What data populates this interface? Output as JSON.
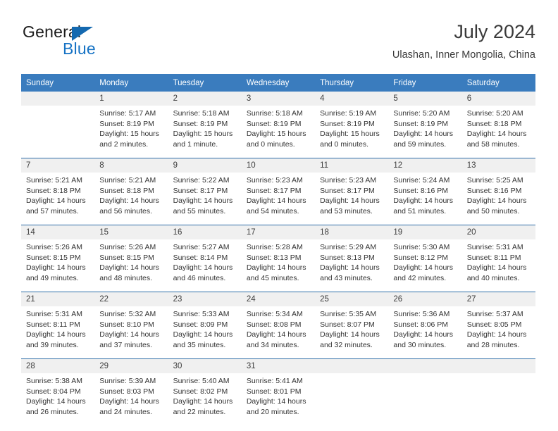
{
  "brand": {
    "name_dark": "General",
    "name_blue": "Blue",
    "accent_color": "#1572c4"
  },
  "header": {
    "title": "July 2024",
    "subtitle": "Ulashan, Inner Mongolia, China"
  },
  "calendar": {
    "header_bg": "#3a7cbe",
    "daynum_bg": "#f0f0f0",
    "week_rule_color": "#2f6ea8",
    "weekdays": [
      "Sunday",
      "Monday",
      "Tuesday",
      "Wednesday",
      "Thursday",
      "Friday",
      "Saturday"
    ],
    "weeks": [
      [
        {
          "day": "",
          "lines": []
        },
        {
          "day": "1",
          "lines": [
            "Sunrise: 5:17 AM",
            "Sunset: 8:19 PM",
            "Daylight: 15 hours",
            "and 2 minutes."
          ]
        },
        {
          "day": "2",
          "lines": [
            "Sunrise: 5:18 AM",
            "Sunset: 8:19 PM",
            "Daylight: 15 hours",
            "and 1 minute."
          ]
        },
        {
          "day": "3",
          "lines": [
            "Sunrise: 5:18 AM",
            "Sunset: 8:19 PM",
            "Daylight: 15 hours",
            "and 0 minutes."
          ]
        },
        {
          "day": "4",
          "lines": [
            "Sunrise: 5:19 AM",
            "Sunset: 8:19 PM",
            "Daylight: 15 hours",
            "and 0 minutes."
          ]
        },
        {
          "day": "5",
          "lines": [
            "Sunrise: 5:20 AM",
            "Sunset: 8:19 PM",
            "Daylight: 14 hours",
            "and 59 minutes."
          ]
        },
        {
          "day": "6",
          "lines": [
            "Sunrise: 5:20 AM",
            "Sunset: 8:18 PM",
            "Daylight: 14 hours",
            "and 58 minutes."
          ]
        }
      ],
      [
        {
          "day": "7",
          "lines": [
            "Sunrise: 5:21 AM",
            "Sunset: 8:18 PM",
            "Daylight: 14 hours",
            "and 57 minutes."
          ]
        },
        {
          "day": "8",
          "lines": [
            "Sunrise: 5:21 AM",
            "Sunset: 8:18 PM",
            "Daylight: 14 hours",
            "and 56 minutes."
          ]
        },
        {
          "day": "9",
          "lines": [
            "Sunrise: 5:22 AM",
            "Sunset: 8:17 PM",
            "Daylight: 14 hours",
            "and 55 minutes."
          ]
        },
        {
          "day": "10",
          "lines": [
            "Sunrise: 5:23 AM",
            "Sunset: 8:17 PM",
            "Daylight: 14 hours",
            "and 54 minutes."
          ]
        },
        {
          "day": "11",
          "lines": [
            "Sunrise: 5:23 AM",
            "Sunset: 8:17 PM",
            "Daylight: 14 hours",
            "and 53 minutes."
          ]
        },
        {
          "day": "12",
          "lines": [
            "Sunrise: 5:24 AM",
            "Sunset: 8:16 PM",
            "Daylight: 14 hours",
            "and 51 minutes."
          ]
        },
        {
          "day": "13",
          "lines": [
            "Sunrise: 5:25 AM",
            "Sunset: 8:16 PM",
            "Daylight: 14 hours",
            "and 50 minutes."
          ]
        }
      ],
      [
        {
          "day": "14",
          "lines": [
            "Sunrise: 5:26 AM",
            "Sunset: 8:15 PM",
            "Daylight: 14 hours",
            "and 49 minutes."
          ]
        },
        {
          "day": "15",
          "lines": [
            "Sunrise: 5:26 AM",
            "Sunset: 8:15 PM",
            "Daylight: 14 hours",
            "and 48 minutes."
          ]
        },
        {
          "day": "16",
          "lines": [
            "Sunrise: 5:27 AM",
            "Sunset: 8:14 PM",
            "Daylight: 14 hours",
            "and 46 minutes."
          ]
        },
        {
          "day": "17",
          "lines": [
            "Sunrise: 5:28 AM",
            "Sunset: 8:13 PM",
            "Daylight: 14 hours",
            "and 45 minutes."
          ]
        },
        {
          "day": "18",
          "lines": [
            "Sunrise: 5:29 AM",
            "Sunset: 8:13 PM",
            "Daylight: 14 hours",
            "and 43 minutes."
          ]
        },
        {
          "day": "19",
          "lines": [
            "Sunrise: 5:30 AM",
            "Sunset: 8:12 PM",
            "Daylight: 14 hours",
            "and 42 minutes."
          ]
        },
        {
          "day": "20",
          "lines": [
            "Sunrise: 5:31 AM",
            "Sunset: 8:11 PM",
            "Daylight: 14 hours",
            "and 40 minutes."
          ]
        }
      ],
      [
        {
          "day": "21",
          "lines": [
            "Sunrise: 5:31 AM",
            "Sunset: 8:11 PM",
            "Daylight: 14 hours",
            "and 39 minutes."
          ]
        },
        {
          "day": "22",
          "lines": [
            "Sunrise: 5:32 AM",
            "Sunset: 8:10 PM",
            "Daylight: 14 hours",
            "and 37 minutes."
          ]
        },
        {
          "day": "23",
          "lines": [
            "Sunrise: 5:33 AM",
            "Sunset: 8:09 PM",
            "Daylight: 14 hours",
            "and 35 minutes."
          ]
        },
        {
          "day": "24",
          "lines": [
            "Sunrise: 5:34 AM",
            "Sunset: 8:08 PM",
            "Daylight: 14 hours",
            "and 34 minutes."
          ]
        },
        {
          "day": "25",
          "lines": [
            "Sunrise: 5:35 AM",
            "Sunset: 8:07 PM",
            "Daylight: 14 hours",
            "and 32 minutes."
          ]
        },
        {
          "day": "26",
          "lines": [
            "Sunrise: 5:36 AM",
            "Sunset: 8:06 PM",
            "Daylight: 14 hours",
            "and 30 minutes."
          ]
        },
        {
          "day": "27",
          "lines": [
            "Sunrise: 5:37 AM",
            "Sunset: 8:05 PM",
            "Daylight: 14 hours",
            "and 28 minutes."
          ]
        }
      ],
      [
        {
          "day": "28",
          "lines": [
            "Sunrise: 5:38 AM",
            "Sunset: 8:04 PM",
            "Daylight: 14 hours",
            "and 26 minutes."
          ]
        },
        {
          "day": "29",
          "lines": [
            "Sunrise: 5:39 AM",
            "Sunset: 8:03 PM",
            "Daylight: 14 hours",
            "and 24 minutes."
          ]
        },
        {
          "day": "30",
          "lines": [
            "Sunrise: 5:40 AM",
            "Sunset: 8:02 PM",
            "Daylight: 14 hours",
            "and 22 minutes."
          ]
        },
        {
          "day": "31",
          "lines": [
            "Sunrise: 5:41 AM",
            "Sunset: 8:01 PM",
            "Daylight: 14 hours",
            "and 20 minutes."
          ]
        },
        {
          "day": "",
          "lines": []
        },
        {
          "day": "",
          "lines": []
        },
        {
          "day": "",
          "lines": []
        }
      ]
    ]
  }
}
